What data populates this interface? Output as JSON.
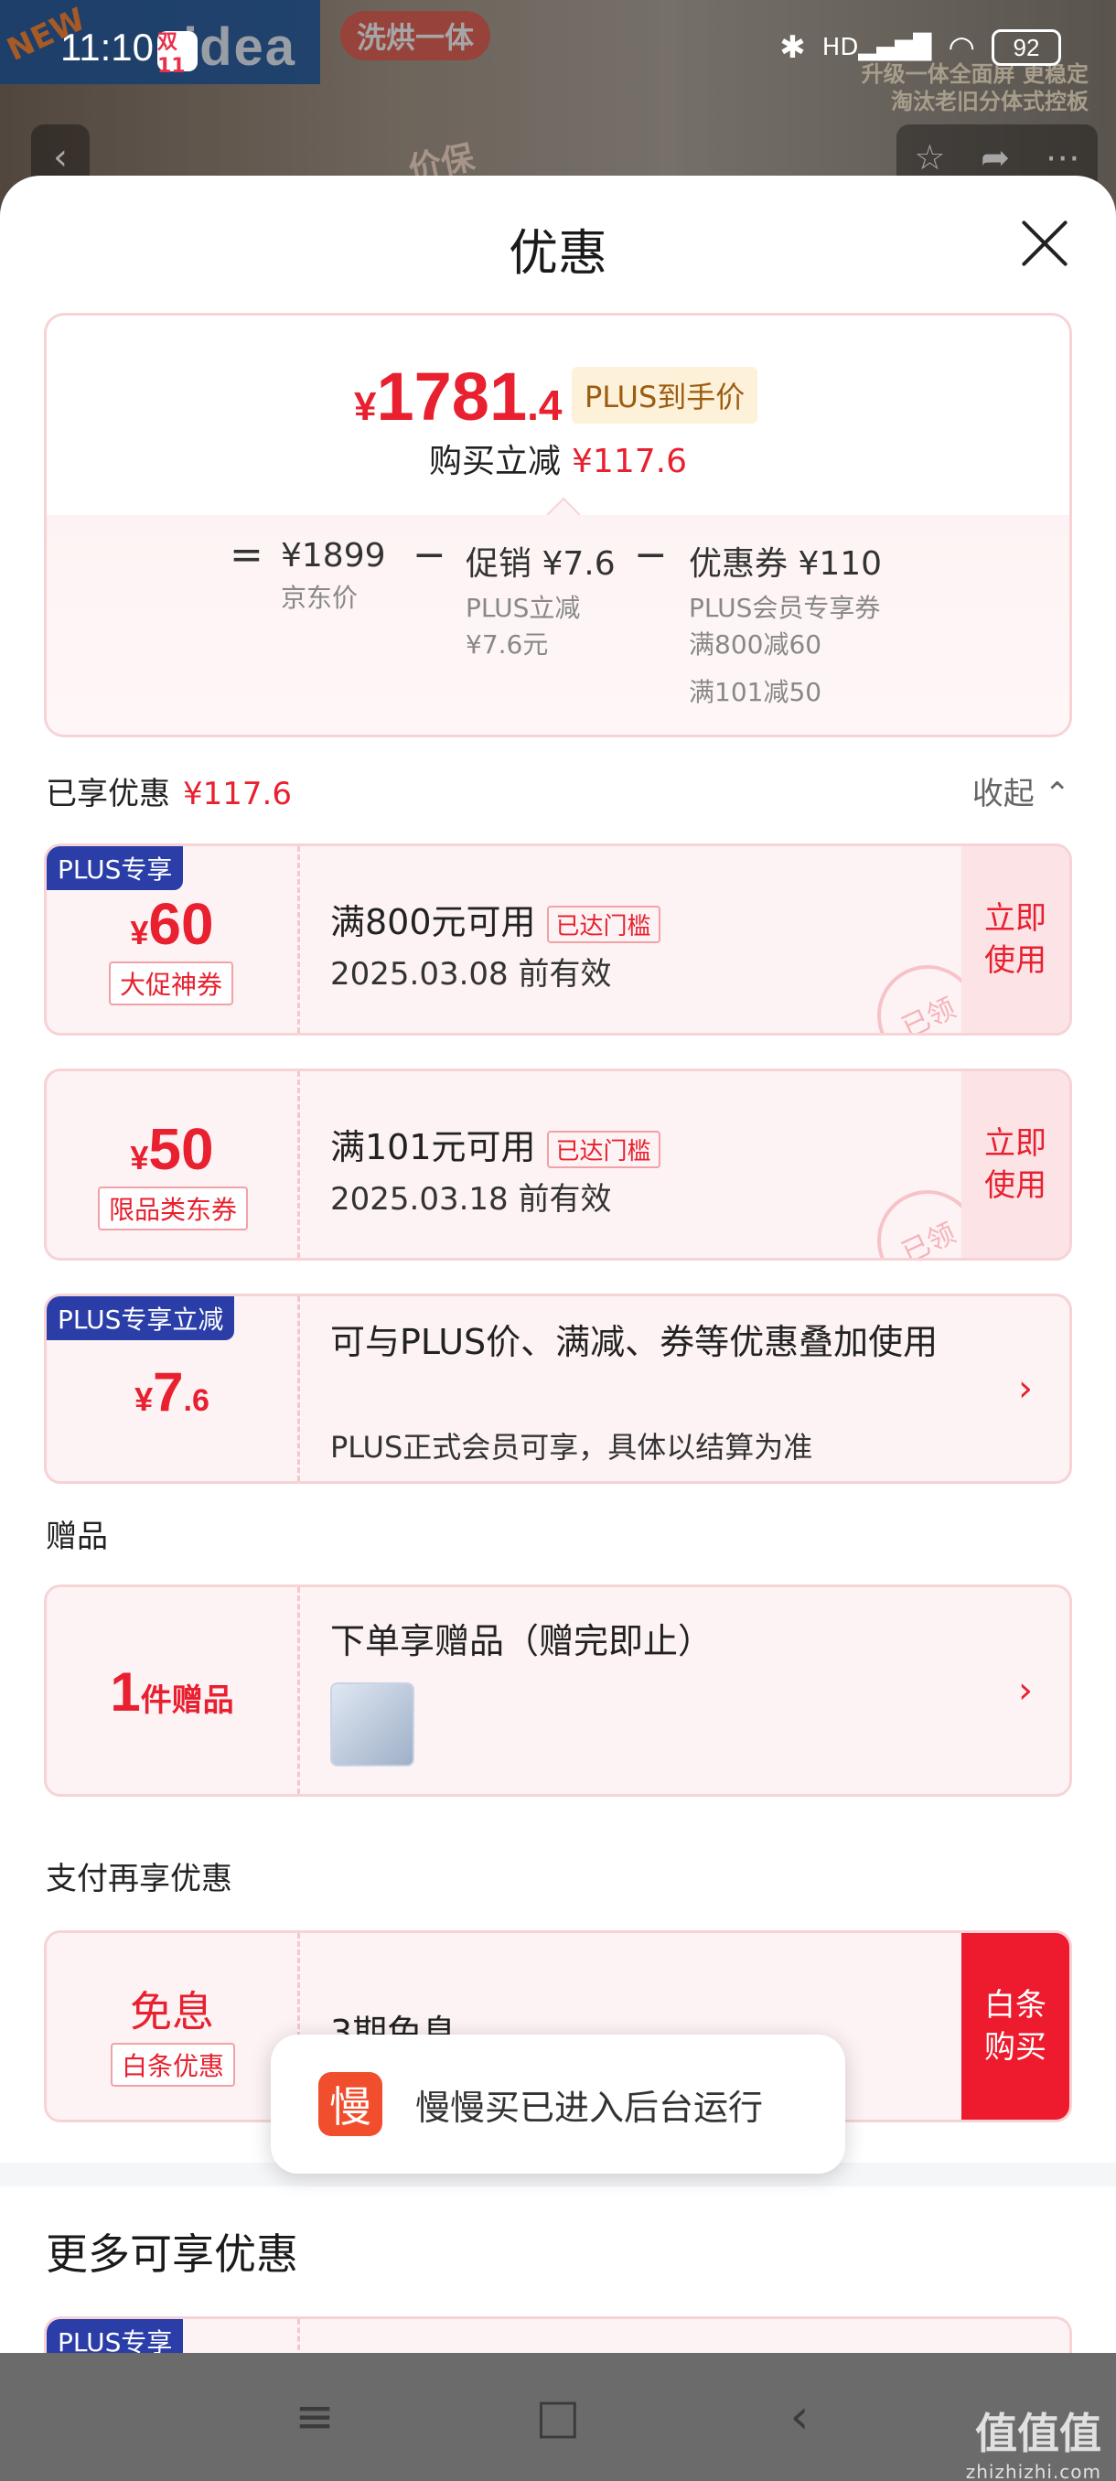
{
  "status": {
    "time": "11:10",
    "app_icon": "双11",
    "battery": "92",
    "signal_label": "HD"
  },
  "background_app": {
    "brand_badge": "NEW",
    "brand": "idea",
    "tag": "洗烘一体",
    "slogan": "升级一体全面屏 更稳定 淘汰老旧分体式控板",
    "price_tag": "价保"
  },
  "sheet": {
    "title": "优惠"
  },
  "summary": {
    "currency": "¥",
    "final_int": "1781",
    "final_dec": ".4",
    "plus_tag": "PLUS到手价",
    "buy_reduce_label": "购买立减",
    "buy_reduce_amount": "¥117.6",
    "eq": "=",
    "minus": "−",
    "jd_price": "¥1899",
    "jd_price_label": "京东价",
    "promo": "促销 ¥7.6",
    "promo_detail_1": "PLUS立减",
    "promo_detail_2": "¥7.6元",
    "coupon": "优惠券 ¥110",
    "coupon_detail_1": "PLUS会员专享券",
    "coupon_detail_2": "满800减60",
    "coupon_detail_3": "满101减50"
  },
  "enjoyed": {
    "label": "已享优惠",
    "amount": "¥117.6",
    "collapse": "收起 ⌃"
  },
  "coupons": [
    {
      "badge": "PLUS专享",
      "cur": "¥",
      "amount": "60",
      "type": "大促神券",
      "condition": "满800元可用",
      "flag": "已达门槛",
      "valid": "2025.03.08 前有效",
      "action": "立即 使用",
      "stamp": "已领"
    },
    {
      "badge": "",
      "cur": "¥",
      "amount": "50",
      "type": "限品类东券",
      "condition": "满101元可用",
      "flag": "已达门槛",
      "valid": "2025.03.18 前有效",
      "action": "立即 使用",
      "stamp": "已领"
    }
  ],
  "plus_reduce": {
    "badge": "PLUS专享立减",
    "cur": "¥",
    "int": "7",
    "dec": ".6",
    "title": "可与PLUS价、满减、券等优惠叠加使用",
    "desc": "PLUS正式会员可享，具体以结算为准"
  },
  "gift_section": {
    "label": "赠品",
    "count": "1",
    "unit": "件赠品",
    "title": "下单享赠品（赠完即止）"
  },
  "pay_section": {
    "label": "支付再享优惠",
    "title": "免息",
    "tag": "白条优惠",
    "desc": "3期免息",
    "action": "白条 购买"
  },
  "more": {
    "title": "更多可享优惠",
    "badge": "PLUS专享"
  },
  "toast": {
    "icon_char": "慢",
    "text": "慢慢买已进入后台运行"
  },
  "watermark": {
    "main": "值值值",
    "sub": "zhizhizhi.com"
  }
}
